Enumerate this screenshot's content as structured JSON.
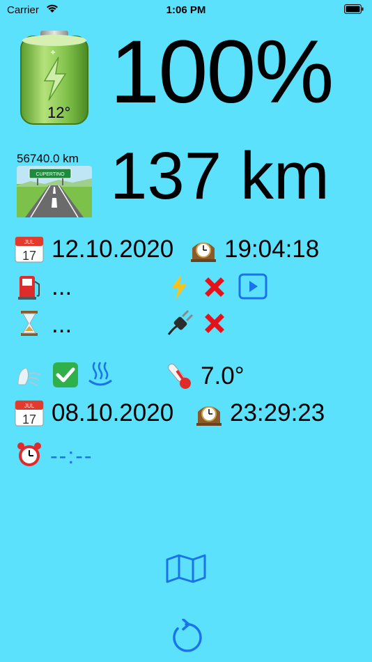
{
  "status_bar": {
    "carrier": "Carrier",
    "time": "1:06 PM"
  },
  "battery": {
    "percent": "100%",
    "temperature": "12°",
    "level": 1.0
  },
  "range": {
    "odometer": "56740.0 km",
    "road_sign": "CUPERTINO",
    "value": "137 km"
  },
  "last_update": {
    "date": "12.10.2020",
    "time": "19:04:18"
  },
  "fuel": {
    "value": "...",
    "charging_icon": "lightning-icon",
    "charging_state": "cross-mark-icon",
    "play_icon": "play-button-icon"
  },
  "timer": {
    "value": "...",
    "plug_icon": "plug-icon",
    "plug_state": "cross-mark-icon"
  },
  "climate": {
    "ventilation_icon": "wind-face-icon",
    "check_icon": "check-mark-icon",
    "heat_icon": "hot-springs-icon",
    "thermometer_icon": "thermometer-icon",
    "temperature": "7.0°"
  },
  "previous": {
    "date": "08.10.2020",
    "time": "23:29:23"
  },
  "alarm": {
    "value": "--:--"
  },
  "colors": {
    "background": "#5ce1fc",
    "accent": "#1a73e8"
  }
}
